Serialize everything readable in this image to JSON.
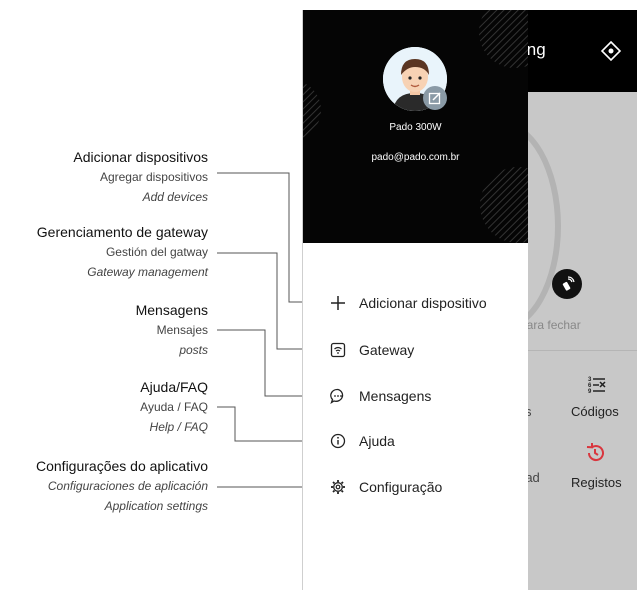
{
  "annotations": [
    {
      "title": "Adicionar dispositivos",
      "spanish": "Agregar dispositivos",
      "english": "Add devices"
    },
    {
      "title": "Gerenciamento de gateway",
      "spanish": "Gestión del gatway",
      "english": "Gateway management"
    },
    {
      "title": "Mensagens",
      "spanish": "Mensajes",
      "english": "posts"
    },
    {
      "title": "Ajuda/FAQ",
      "spanish": "Ayuda / FAQ",
      "english": "Help / FAQ"
    },
    {
      "title": "Configurações do aplicativo",
      "spanish": "Configuraciones de aplicación",
      "english": "Application settings"
    }
  ],
  "app_bar": {
    "title_fragment": "ing"
  },
  "background": {
    "hint_fragment": "o para fechar",
    "s_fragment": "s",
    "codes_label": "Códigos",
    "rad_fragment": "rad",
    "registros_label": "Registos"
  },
  "drawer": {
    "user_name": "Pado 300W",
    "user_email": "pado@pado.com.br",
    "menu": [
      {
        "label": "Adicionar dispositivo",
        "icon": "plus-icon"
      },
      {
        "label": "Gateway",
        "icon": "gateway-icon"
      },
      {
        "label": "Mensagens",
        "icon": "message-icon"
      },
      {
        "label": "Ajuda",
        "icon": "info-icon"
      },
      {
        "label": "Configuração",
        "icon": "gear-icon"
      }
    ]
  },
  "colors": {
    "drawer_header": "#050505",
    "app_bar": "#000000",
    "accent_red": "#d9363e",
    "overlay": "#c8c8c8"
  }
}
